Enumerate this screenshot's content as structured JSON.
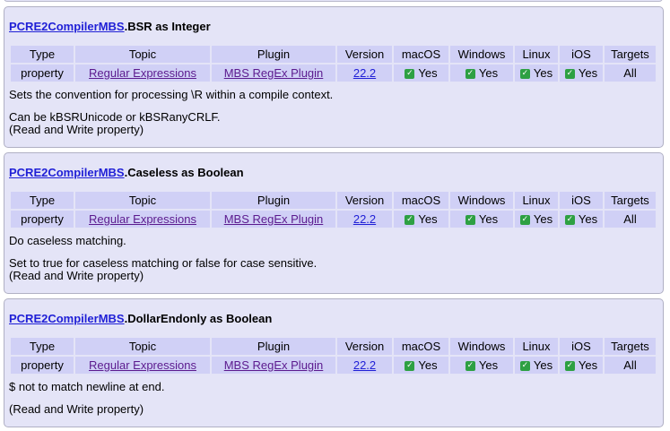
{
  "headers": [
    "Type",
    "Topic",
    "Plugin",
    "Version",
    "macOS",
    "Windows",
    "Linux",
    "iOS",
    "Targets"
  ],
  "entries": [
    {
      "class_link": "PCRE2CompilerMBS",
      "title_rest": ".BSR as Integer",
      "row": {
        "type": "property",
        "topic": "Regular Expressions",
        "plugin": "MBS RegEx Plugin",
        "version": "22.2",
        "macos": "Yes",
        "windows": "Yes",
        "linux": "Yes",
        "ios": "Yes",
        "targets": "All"
      },
      "description": "Sets the convention for processing \\R within a compile context.",
      "note1": "Can be kBSRUnicode or kBSRanyCRLF.",
      "note2": "(Read and Write property)"
    },
    {
      "class_link": "PCRE2CompilerMBS",
      "title_rest": ".Caseless as Boolean",
      "row": {
        "type": "property",
        "topic": "Regular Expressions",
        "plugin": "MBS RegEx Plugin",
        "version": "22.2",
        "macos": "Yes",
        "windows": "Yes",
        "linux": "Yes",
        "ios": "Yes",
        "targets": "All"
      },
      "description": "Do caseless matching.",
      "note1": "Set to true for caseless matching or false for case sensitive.",
      "note2": "(Read and Write property)"
    },
    {
      "class_link": "PCRE2CompilerMBS",
      "title_rest": ".DollarEndonly as Boolean",
      "row": {
        "type": "property",
        "topic": "Regular Expressions",
        "plugin": "MBS RegEx Plugin",
        "version": "22.2",
        "macos": "Yes",
        "windows": "Yes",
        "linux": "Yes",
        "ios": "Yes",
        "targets": "All"
      },
      "description": "$ not to match newline at end.",
      "note1": "",
      "note2": "(Read and Write property)"
    }
  ]
}
